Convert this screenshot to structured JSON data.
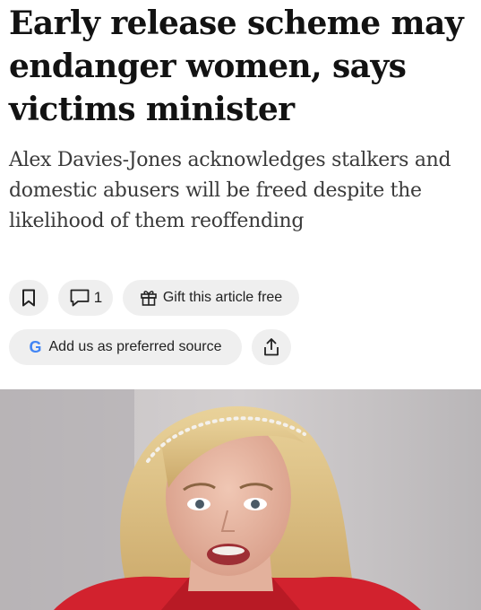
{
  "article": {
    "headline": "Early release scheme may endanger women, says victims minister",
    "standfirst": "Alex Davies-Jones acknowledges stalkers and domestic abusers will be freed despite the likelihood of them reoffending"
  },
  "actions": {
    "save_icon": "bookmark-icon",
    "comment_icon": "comment-icon",
    "comment_count": "1",
    "gift_icon": "gift-icon",
    "gift_label": "Gift this article free",
    "source_icon": "google-icon",
    "source_logo_letter": "G",
    "source_label": "Add us as preferred source",
    "share_icon": "share-icon"
  },
  "colors": {
    "google_blue": "#4285F4",
    "pill_background": "#efefef",
    "text": "#121212"
  },
  "hero_image": {
    "subject": "photo of a woman with blonde hair wearing a pearl headband and red top, speaking"
  }
}
